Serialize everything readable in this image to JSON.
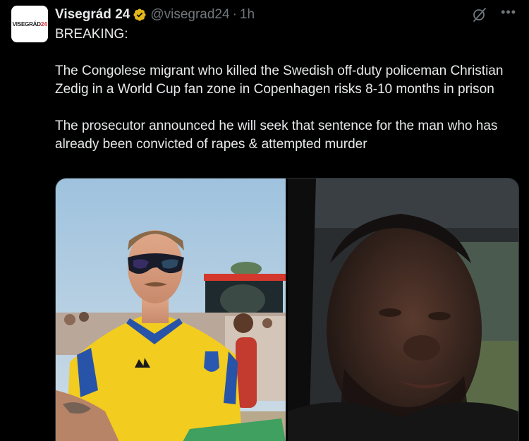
{
  "account": {
    "avatar_text_main": "VISEGRÁD",
    "avatar_text_accent": "24",
    "display_name": "Visegrád 24",
    "handle": "@visegrad24",
    "separator": "·",
    "time": "1h"
  },
  "icons": {
    "verified": "verified-badge-icon",
    "grok": "grok-icon",
    "more": "more-icon"
  },
  "tweet": {
    "line1": "BREAKING:",
    "paragraph1": "The Congolese migrant who killed the Swedish off-duty policeman Christian Zedig in a World Cup fan zone in Copenhagen risks 8-10 months in prison",
    "paragraph2": "The prosecutor announced he will seek that sentence for the man who has already been convicted of rapes & attempted murder"
  },
  "colors": {
    "background": "#000000",
    "text": "#e7e9ea",
    "muted": "#71767b",
    "verified_gold": "#e2b719",
    "border": "#2f3336"
  }
}
